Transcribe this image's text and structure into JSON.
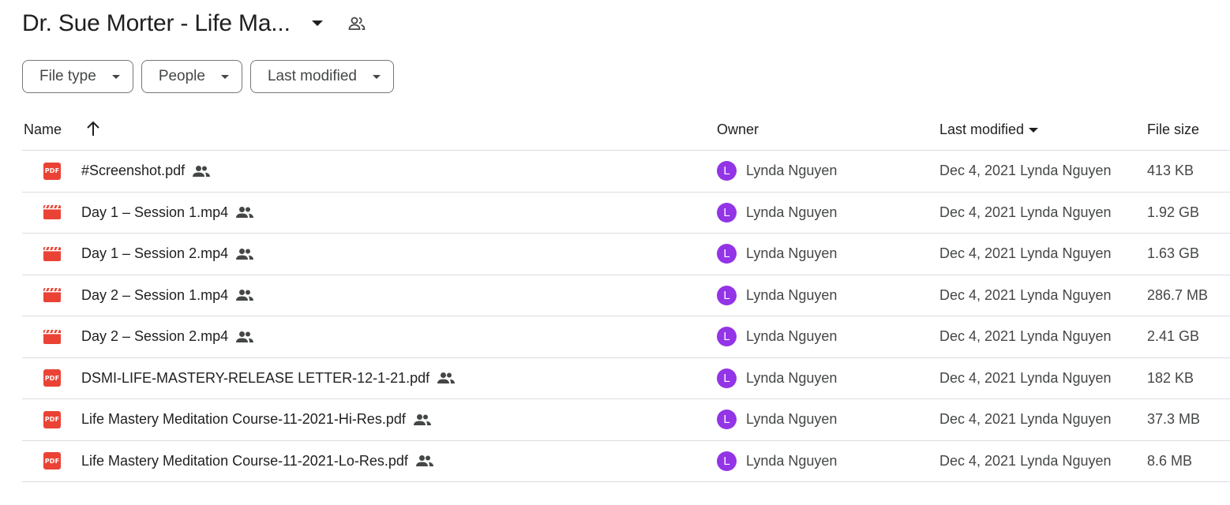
{
  "folder": {
    "title": "Dr. Sue Morter - Life Ma..."
  },
  "filters": [
    {
      "label": "File type"
    },
    {
      "label": "People"
    },
    {
      "label": "Last modified"
    }
  ],
  "columns": {
    "name": "Name",
    "owner": "Owner",
    "last_modified": "Last modified",
    "file_size": "File size"
  },
  "colors": {
    "pdf": "#ea4335",
    "video": "#ea4335",
    "avatar": "#9334e6"
  },
  "files": [
    {
      "type": "pdf",
      "icon": "pdf-icon",
      "name": "#Screenshot.pdf",
      "owner_initial": "L",
      "owner": "Lynda Nguyen",
      "modified": "Dec 4, 2021 Lynda Nguyen",
      "size": "413 KB"
    },
    {
      "type": "video",
      "icon": "video-icon",
      "name": "Day 1 – Session 1.mp4",
      "owner_initial": "L",
      "owner": "Lynda Nguyen",
      "modified": "Dec 4, 2021 Lynda Nguyen",
      "size": "1.92 GB"
    },
    {
      "type": "video",
      "icon": "video-icon",
      "name": "Day 1 – Session 2.mp4",
      "owner_initial": "L",
      "owner": "Lynda Nguyen",
      "modified": "Dec 4, 2021 Lynda Nguyen",
      "size": "1.63 GB"
    },
    {
      "type": "video",
      "icon": "video-icon",
      "name": "Day 2 – Session 1.mp4",
      "owner_initial": "L",
      "owner": "Lynda Nguyen",
      "modified": "Dec 4, 2021 Lynda Nguyen",
      "size": "286.7 MB"
    },
    {
      "type": "video",
      "icon": "video-icon",
      "name": "Day 2 – Session 2.mp4",
      "owner_initial": "L",
      "owner": "Lynda Nguyen",
      "modified": "Dec 4, 2021 Lynda Nguyen",
      "size": "2.41 GB"
    },
    {
      "type": "pdf",
      "icon": "pdf-icon",
      "name": "DSMI-LIFE-MASTERY-RELEASE LETTER-12-1-21.pdf",
      "owner_initial": "L",
      "owner": "Lynda Nguyen",
      "modified": "Dec 4, 2021 Lynda Nguyen",
      "size": "182 KB"
    },
    {
      "type": "pdf",
      "icon": "pdf-icon",
      "name": "Life Mastery Meditation Course-11-2021-Hi-Res.pdf",
      "owner_initial": "L",
      "owner": "Lynda Nguyen",
      "modified": "Dec 4, 2021 Lynda Nguyen",
      "size": "37.3 MB"
    },
    {
      "type": "pdf",
      "icon": "pdf-icon",
      "name": "Life Mastery Meditation Course-11-2021-Lo-Res.pdf",
      "owner_initial": "L",
      "owner": "Lynda Nguyen",
      "modified": "Dec 4, 2021 Lynda Nguyen",
      "size": "8.6 MB"
    }
  ]
}
